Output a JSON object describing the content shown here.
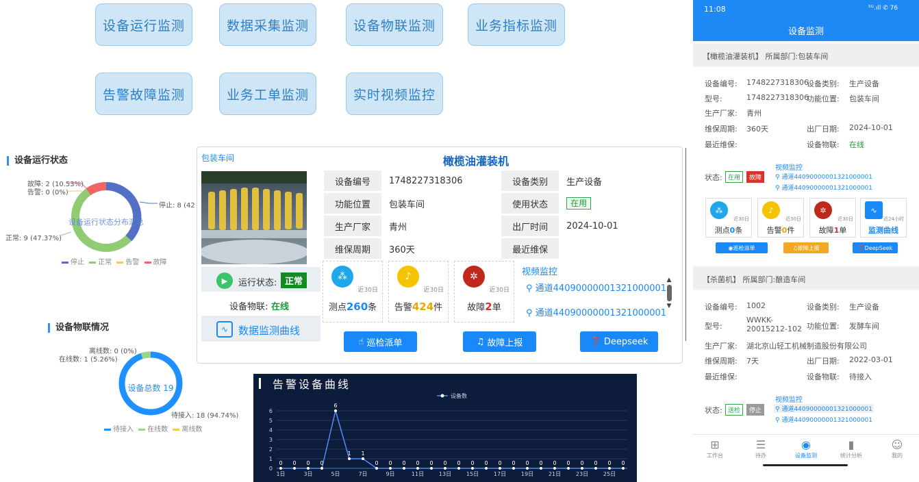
{
  "nav": [
    "设备运行监测",
    "数据采集监测",
    "设备物联监测",
    "业务指标监测",
    "告警故障监测",
    "业务工单监测",
    "实时视频监控"
  ],
  "run_status": {
    "title": "设备运行状态",
    "center": "设备运行状态分布汇总",
    "labels": {
      "fault": "故障: 2 (10.53%)",
      "alarm": "告警: 0 (0%)",
      "stop": "停止: 8 (42",
      "normal": "正常: 9 (47.37%)"
    },
    "legend": [
      "停止",
      "正常",
      "告警",
      "故障"
    ],
    "colors": {
      "stop": "#5470c6",
      "normal": "#91cc75",
      "alarm": "#fac858",
      "fault": "#ee6666"
    }
  },
  "iot": {
    "title": "设备物联情况",
    "center": "设备总数 19",
    "labels": {
      "offline": "离线数: 0 (0%)",
      "online": "在线数: 1 (5.26%)",
      "pending": "待接入: 18 (94.74%)"
    },
    "legend": [
      "待接入",
      "在线数",
      "离线数"
    ]
  },
  "card": {
    "dept": "包装车间",
    "title": "橄榄油灌装机",
    "table": [
      [
        "设备编号",
        "1748227318306",
        "设备类别",
        "生产设备"
      ],
      [
        "功能位置",
        "包装车间",
        "使用状态",
        "在用"
      ],
      [
        "生产厂家",
        "青州",
        "出厂时间",
        "2024-10-01"
      ],
      [
        "维保周期",
        "360天",
        "最近维保",
        ""
      ]
    ],
    "run_label": "运行状态:",
    "run_value": "正常",
    "iot_label": "设备物联:",
    "iot_value": "在线",
    "curve": "数据监测曲线",
    "stats": [
      {
        "pre": "测点",
        "num": "260",
        "suf": "条",
        "days": "近30日",
        "color": "#1ea7ea",
        "numcolor": "#1989fa"
      },
      {
        "pre": "告警",
        "num": "424",
        "suf": "件",
        "days": "近30日",
        "color": "#f5c400",
        "numcolor": "#e6a800"
      },
      {
        "pre": "故障",
        "num": "2",
        "suf": "单",
        "days": "近30日",
        "color": "#c0281c",
        "numcolor": "#d32f2f"
      }
    ],
    "video_title": "视频监控",
    "channels": [
      "通道44090000001321000001",
      "通道44090000001321000001"
    ],
    "buttons": [
      "巡检派单",
      "故障上报",
      "Deepseek"
    ]
  },
  "alarm_chart": {
    "title": "告警设备曲线",
    "legend": "设备数"
  },
  "chart_data": {
    "type": "line",
    "title": "告警设备曲线",
    "series": [
      {
        "name": "设备数",
        "values": [
          0,
          0,
          0,
          0,
          6,
          1,
          1,
          0,
          0,
          0,
          0,
          0,
          0,
          0,
          0,
          0,
          0,
          0,
          0,
          0,
          0,
          0,
          0,
          0,
          0,
          0
        ]
      }
    ],
    "x": [
      "1日",
      "2日",
      "3日",
      "4日",
      "5日",
      "6日",
      "7日",
      "8日",
      "9日",
      "10日",
      "11日",
      "12日",
      "13日",
      "14日",
      "15日",
      "16日",
      "17日",
      "18日",
      "19日",
      "20日",
      "21日",
      "22日",
      "23日",
      "24日",
      "25日",
      "26日"
    ],
    "xticks": [
      "1日",
      "3日",
      "5日",
      "7日",
      "9日",
      "11日",
      "13日",
      "15日",
      "17日",
      "19日",
      "21日",
      "23日",
      "25日"
    ],
    "yticks": [
      "0",
      "1",
      "2",
      "3",
      "4",
      "5",
      "6"
    ],
    "ylim": [
      0,
      6
    ]
  },
  "phone": {
    "status_time": "11:08",
    "status_right": "⁵ᴳ.ıll ✆ 76",
    "title": "设备监测",
    "dev1": {
      "header": "【橄榄油灌装机】 所属部门:包装车间",
      "rows": [
        [
          "设备编号:",
          "1748227318306",
          "设备类别:",
          "生产设备"
        ],
        [
          "型号:",
          "1748227318306",
          "功能位置:",
          "包装车间"
        ],
        [
          "生产厂家:",
          "青州",
          "",
          ""
        ],
        [
          "维保周期:",
          "360天",
          "出厂日期:",
          "2024-10-01"
        ],
        [
          "最近维保:",
          "",
          "设备物联:",
          "在线"
        ]
      ],
      "status_label": "状态:",
      "tags": [
        "在用",
        "故障"
      ],
      "video": "视频监控",
      "channels": [
        "通道44090000001321000001",
        "通道44090000001321000001"
      ],
      "minis": [
        {
          "pre": "测点",
          "num": "0",
          "suf": "条",
          "days": "近30日"
        },
        {
          "pre": "告警",
          "num": "0",
          "suf": "件",
          "days": "近30日"
        },
        {
          "pre": "故障",
          "num": "1",
          "suf": "单",
          "days": "近30日"
        },
        {
          "pre": "监测曲线",
          "num": "",
          "suf": "",
          "days": "近24小时"
        }
      ],
      "buttons": [
        "巡检派单",
        "故障上报",
        "DeepSeek"
      ]
    },
    "dev2": {
      "header": "【杀菌机】 所属部门:酿造车间",
      "rows": [
        [
          "设备编号:",
          "1002",
          "设备类别:",
          "生产设备"
        ],
        [
          "型号:",
          "WWKK-20015212-102",
          "功能位置:",
          "发酵车间"
        ],
        [
          "生产厂家:",
          "湖北京山轻工机械制造股份有限公司",
          "",
          ""
        ],
        [
          "维保周期:",
          "7天",
          "出厂日期:",
          "2022-03-01"
        ],
        [
          "最近维保:",
          "",
          "设备物联:",
          "待接入"
        ]
      ],
      "status_label": "状态:",
      "tags": [
        "送检",
        "停止"
      ],
      "video": "视频监控",
      "channels": [
        "通道44090000001321000001",
        "通道44090000001321000001"
      ]
    },
    "tabs": [
      "工作台",
      "待办",
      "设备监测",
      "统计分析",
      "我的"
    ]
  }
}
